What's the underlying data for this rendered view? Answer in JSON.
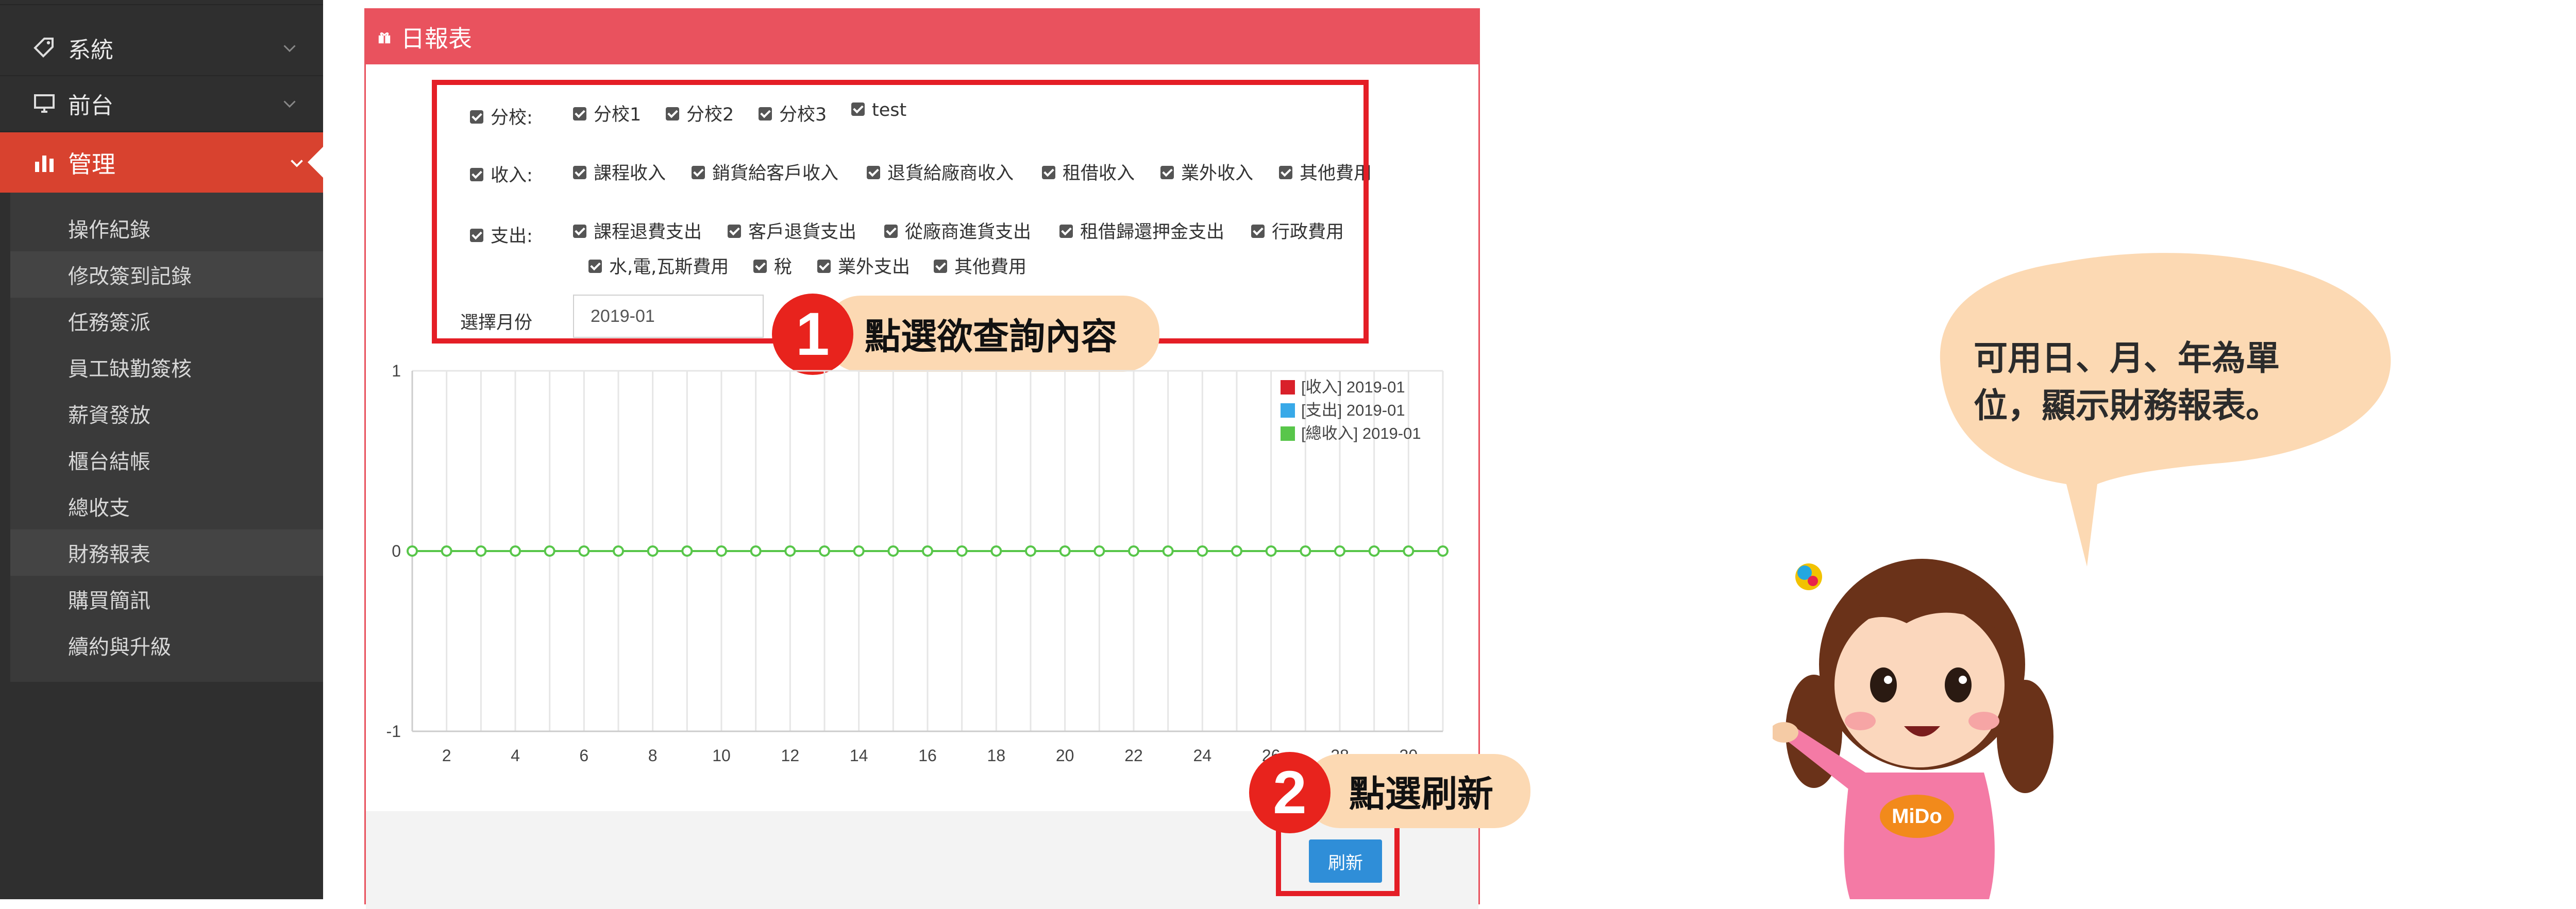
{
  "sidebar": {
    "top_items": [
      {
        "label": "系統"
      },
      {
        "label": "前台"
      },
      {
        "label": "管理"
      }
    ],
    "sub_items": [
      {
        "label": "操作紀錄"
      },
      {
        "label": "修改簽到記錄"
      },
      {
        "label": "任務簽派"
      },
      {
        "label": "員工缺勤簽核"
      },
      {
        "label": "薪資發放"
      },
      {
        "label": "櫃台結帳"
      },
      {
        "label": "總收支"
      },
      {
        "label": "財務報表"
      },
      {
        "label": "購買簡訊"
      },
      {
        "label": "續約與升級"
      }
    ]
  },
  "report": {
    "title": "日報表",
    "filters": {
      "branch": {
        "label": "分校:",
        "options": [
          "分校1",
          "分校2",
          "分校3",
          "test"
        ]
      },
      "income": {
        "label": "收入:",
        "options": [
          "課程收入",
          "銷貨給客戶收入",
          "退貨給廠商收入",
          "租借收入",
          "業外收入",
          "其他費用"
        ]
      },
      "expense": {
        "label": "支出:",
        "options": [
          "課程退費支出",
          "客戶退貨支出",
          "從廠商進貨支出",
          "租借歸還押金支出",
          "行政費用",
          "水,電,瓦斯費用",
          "稅",
          "業外支出",
          "其他費用"
        ]
      },
      "month": {
        "label": "選擇月份",
        "value": "2019-01"
      }
    },
    "refresh_label": "刷新"
  },
  "callouts": [
    {
      "number": "1",
      "text": "點選欲查詢內容"
    },
    {
      "number": "2",
      "text": "點選刷新"
    }
  ],
  "bubble": {
    "line1": "可用日、月、年為單",
    "line2": "位，顯示財務報表。"
  },
  "mascot": {
    "shirt_text": "MiDo"
  },
  "chart_data": {
    "type": "line",
    "x": [
      1,
      2,
      3,
      4,
      5,
      6,
      7,
      8,
      9,
      10,
      11,
      12,
      13,
      14,
      15,
      16,
      17,
      18,
      19,
      20,
      21,
      22,
      23,
      24,
      25,
      26,
      27,
      28,
      29,
      30,
      31
    ],
    "x_ticks": [
      2,
      4,
      6,
      8,
      10,
      12,
      14,
      16,
      18,
      20,
      22,
      24,
      26,
      28,
      30
    ],
    "y_ticks": [
      -1,
      0,
      1
    ],
    "ylim": [
      -1,
      1
    ],
    "grid": true,
    "legend_position": "top-right",
    "series": [
      {
        "name": "[收入] 2019-01",
        "color": "#d9202a",
        "values": [
          0,
          0,
          0,
          0,
          0,
          0,
          0,
          0,
          0,
          0,
          0,
          0,
          0,
          0,
          0,
          0,
          0,
          0,
          0,
          0,
          0,
          0,
          0,
          0,
          0,
          0,
          0,
          0,
          0,
          0,
          0
        ]
      },
      {
        "name": "[支出] 2019-01",
        "color": "#38a9e8",
        "values": [
          0,
          0,
          0,
          0,
          0,
          0,
          0,
          0,
          0,
          0,
          0,
          0,
          0,
          0,
          0,
          0,
          0,
          0,
          0,
          0,
          0,
          0,
          0,
          0,
          0,
          0,
          0,
          0,
          0,
          0,
          0
        ]
      },
      {
        "name": "[總收入] 2019-01",
        "color": "#58c64a",
        "values": [
          0,
          0,
          0,
          0,
          0,
          0,
          0,
          0,
          0,
          0,
          0,
          0,
          0,
          0,
          0,
          0,
          0,
          0,
          0,
          0,
          0,
          0,
          0,
          0,
          0,
          0,
          0,
          0,
          0,
          0,
          0
        ]
      }
    ]
  }
}
